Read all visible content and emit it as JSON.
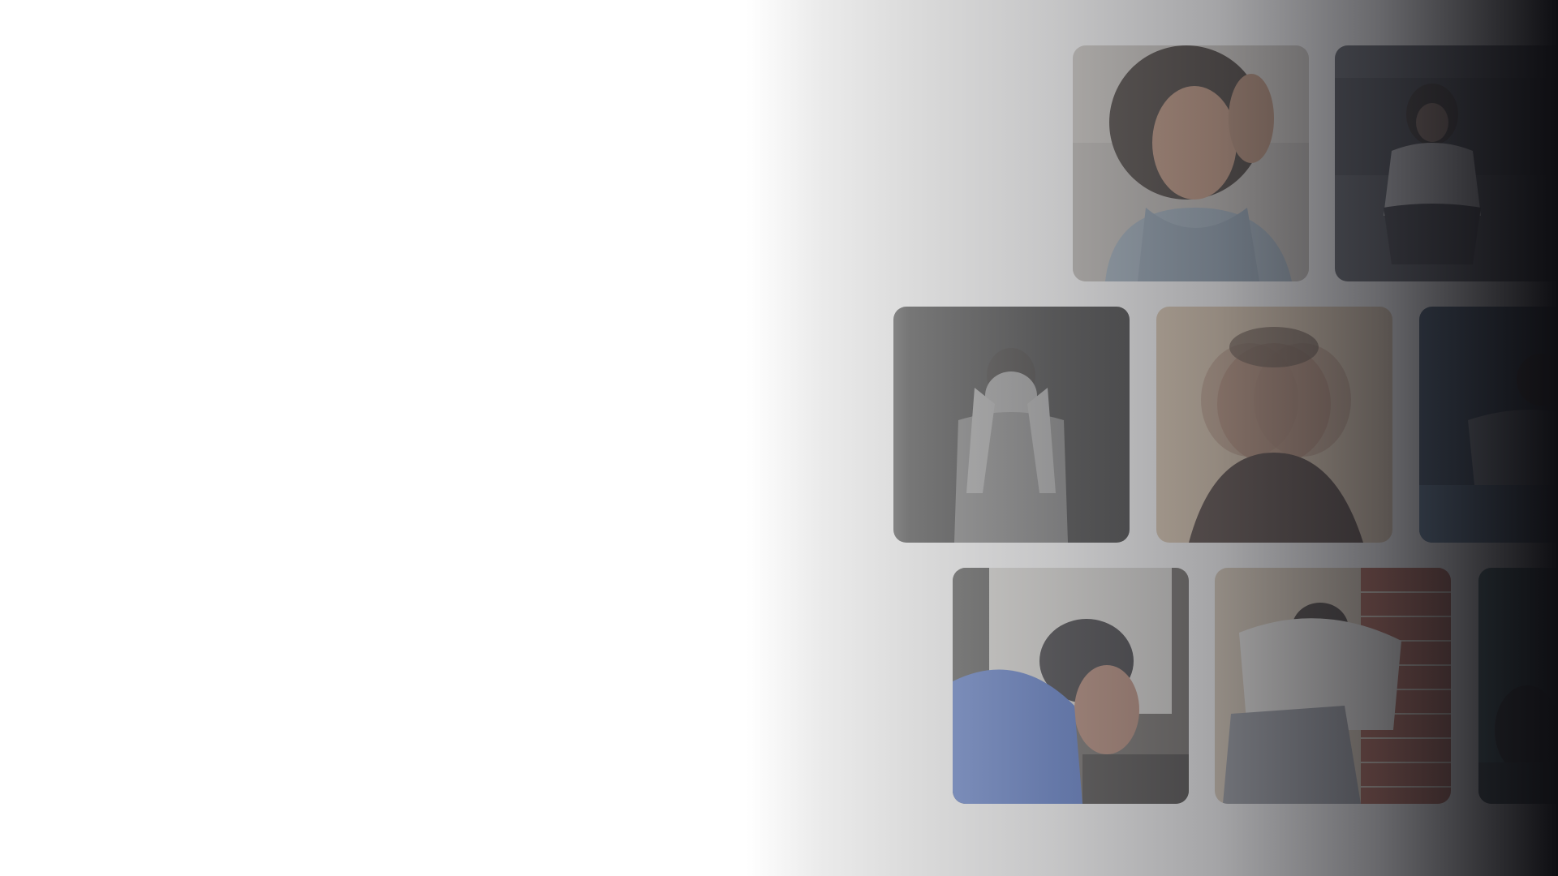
{
  "gallery": {
    "tiles": [
      {
        "name": "photo-woman-curly-hair-hand-on-head",
        "icon": "photo-icon"
      },
      {
        "name": "photo-woman-sitting-on-floor-dark-room",
        "icon": "photo-icon"
      },
      {
        "name": "photo-man-covering-face-dark",
        "icon": "photo-icon"
      },
      {
        "name": "photo-man-blurred-motion-hands-on-head",
        "icon": "photo-icon"
      },
      {
        "name": "photo-man-sitting-on-bed-dark",
        "icon": "photo-icon"
      },
      {
        "name": "photo-man-blue-shirt-hands-on-head",
        "icon": "photo-icon"
      },
      {
        "name": "photo-man-sitting-by-brick-wall",
        "icon": "photo-icon"
      },
      {
        "name": "photo-person-dark-teal-room",
        "icon": "photo-icon"
      }
    ]
  },
  "colors": {
    "background": "#ffffff",
    "overlay_dark": "#0e0e12"
  }
}
